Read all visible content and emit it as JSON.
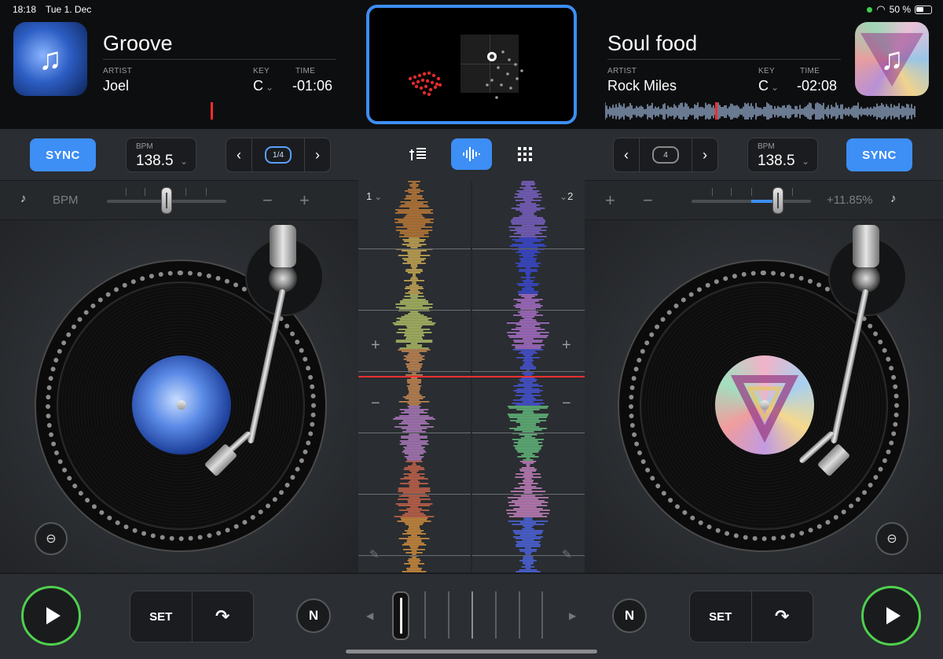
{
  "status": {
    "time": "18:18",
    "date": "Tue 1. Dec",
    "battery": "50 %"
  },
  "deck_left": {
    "title": "Groove",
    "artist_label": "ARTIST",
    "artist": "Joel",
    "key_label": "KEY",
    "key": "C",
    "time_label": "TIME",
    "time": "-01:06",
    "sync": "SYNC",
    "bpm_label": "BPM",
    "bpm": "138.5",
    "loop": "1/4",
    "pitch_label": "BPM",
    "lane_number": "1",
    "set": "SET",
    "art_icon": "music-note-icon"
  },
  "deck_right": {
    "title": "Soul food",
    "artist_label": "ARTIST",
    "artist": "Rock Miles",
    "key_label": "KEY",
    "key": "C",
    "time_label": "TIME",
    "time": "-02:08",
    "sync": "SYNC",
    "bpm_label": "BPM",
    "bpm": "138.5",
    "loop": "4",
    "pitch_value": "+11.85%",
    "lane_number": "2",
    "set": "SET",
    "art_icon": "music-note-icon"
  },
  "center": {
    "tools": [
      "mixer-icon",
      "waveform-icon",
      "pads-icon"
    ],
    "active_tool": "waveform-icon"
  },
  "glyphs": {
    "chev_down": "⌄",
    "prev": "‹",
    "next": "›",
    "plus": "+",
    "minus": "−",
    "note": "♪",
    "pencil": "✎",
    "n": "N",
    "arrow_left": "◀",
    "arrow_right": "▶",
    "cue": "↷",
    "music": "♫",
    "wifi": "◠"
  },
  "colors": {
    "accent": "#3d8ef5",
    "play_ring": "#4fd04f",
    "playhead": "#ff2d2d"
  }
}
